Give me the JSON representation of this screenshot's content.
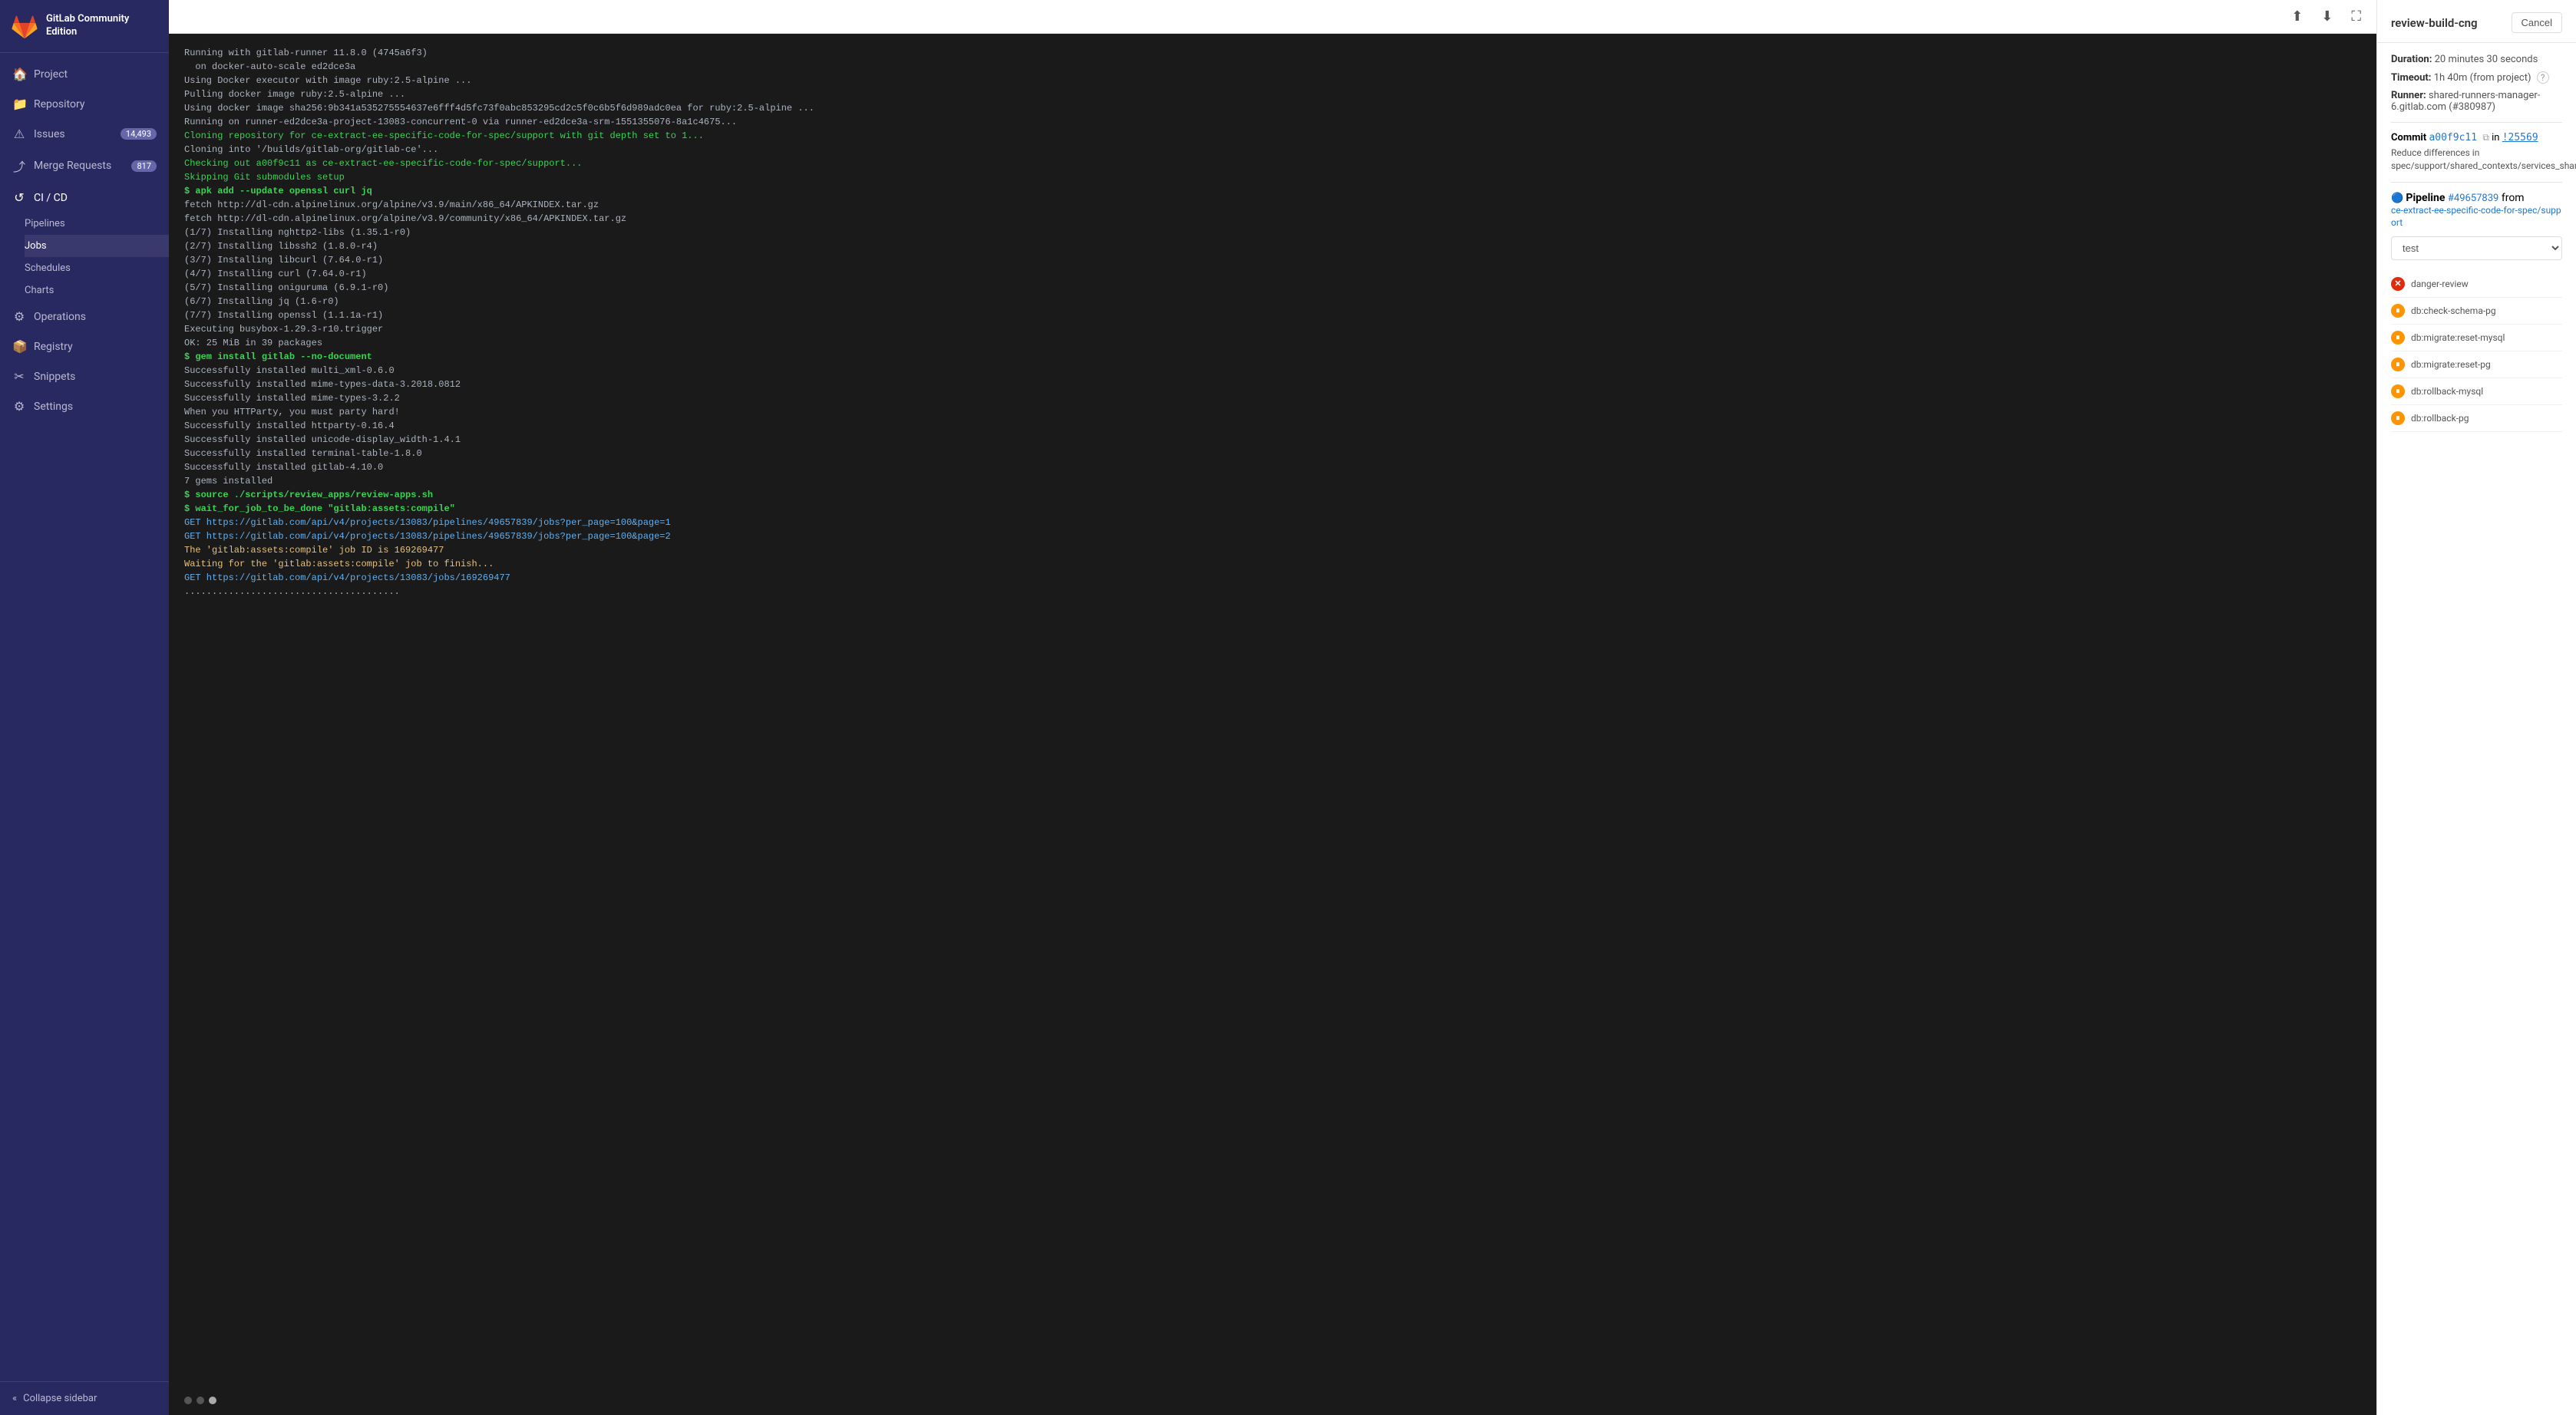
{
  "sidebar": {
    "app_name": "GitLab Community Edition",
    "logo_color": "#e24329",
    "nav_items": [
      {
        "id": "project",
        "label": "Project",
        "icon": "🏠",
        "badge": null
      },
      {
        "id": "repository",
        "label": "Repository",
        "icon": "📁",
        "badge": null
      },
      {
        "id": "issues",
        "label": "Issues",
        "icon": "⚠️",
        "badge": "14,493"
      },
      {
        "id": "merge-requests",
        "label": "Merge Requests",
        "icon": "⤴",
        "badge": "817"
      },
      {
        "id": "cicd",
        "label": "CI / CD",
        "icon": "🔁",
        "badge": null,
        "expanded": true,
        "children": [
          {
            "id": "pipelines",
            "label": "Pipelines"
          },
          {
            "id": "jobs",
            "label": "Jobs",
            "active": true
          },
          {
            "id": "schedules",
            "label": "Schedules"
          },
          {
            "id": "charts",
            "label": "Charts"
          }
        ]
      },
      {
        "id": "operations",
        "label": "Operations",
        "icon": "⚙",
        "badge": null
      },
      {
        "id": "registry",
        "label": "Registry",
        "icon": "📦",
        "badge": null
      },
      {
        "id": "snippets",
        "label": "Snippets",
        "icon": "✂",
        "badge": null
      },
      {
        "id": "settings",
        "label": "Settings",
        "icon": "⚙",
        "badge": null
      }
    ],
    "collapse_label": "Collapse sidebar"
  },
  "toolbar": {
    "scroll_to_top_icon": "⬆",
    "scroll_bottom_icon": "⬇",
    "fullscreen_icon": "⛶"
  },
  "terminal": {
    "lines": [
      {
        "text": "Running with gitlab-runner 11.8.0 (4745a6f3)",
        "style": "white"
      },
      {
        "text": "  on docker-auto-scale ed2dce3a",
        "style": "white"
      },
      {
        "text": "Using Docker executor with image ruby:2.5-alpine ...",
        "style": "white"
      },
      {
        "text": "Pulling docker image ruby:2.5-alpine ...",
        "style": "white"
      },
      {
        "text": "Using docker image sha256:9b341a535275554637e6fff4d5fc73f0abc853295cd2c5f0c6b5f6d989adc0ea for ruby:2.5-alpine ...",
        "style": "white"
      },
      {
        "text": "Running on runner-ed2dce3a-project-13083-concurrent-0 via runner-ed2dce3a-srm-1551355076-8a1c4675...",
        "style": "white"
      },
      {
        "text": "Cloning repository for ce-extract-ee-specific-code-for-spec/support with git depth set to 1...",
        "style": "green"
      },
      {
        "text": "Cloning into '/builds/gitlab-org/gitlab-ce'...",
        "style": "white"
      },
      {
        "text": "Checking out a00f9c11 as ce-extract-ee-specific-code-for-spec/support...",
        "style": "green"
      },
      {
        "text": "Skipping Git submodules setup",
        "style": "green"
      },
      {
        "text": "$ apk add --update openssl curl jq",
        "style": "cmd"
      },
      {
        "text": "fetch http://dl-cdn.alpinelinux.org/alpine/v3.9/main/x86_64/APKINDEX.tar.gz",
        "style": "white"
      },
      {
        "text": "fetch http://dl-cdn.alpinelinux.org/alpine/v3.9/community/x86_64/APKINDEX.tar.gz",
        "style": "white"
      },
      {
        "text": "(1/7) Installing nghttp2-libs (1.35.1-r0)",
        "style": "white"
      },
      {
        "text": "(2/7) Installing libssh2 (1.8.0-r4)",
        "style": "white"
      },
      {
        "text": "(3/7) Installing libcurl (7.64.0-r1)",
        "style": "white"
      },
      {
        "text": "(4/7) Installing curl (7.64.0-r1)",
        "style": "white"
      },
      {
        "text": "(5/7) Installing oniguruma (6.9.1-r0)",
        "style": "white"
      },
      {
        "text": "(6/7) Installing jq (1.6-r0)",
        "style": "white"
      },
      {
        "text": "(7/7) Installing openssl (1.1.1a-r1)",
        "style": "white"
      },
      {
        "text": "Executing busybox-1.29.3-r10.trigger",
        "style": "white"
      },
      {
        "text": "OK: 25 MiB in 39 packages",
        "style": "white"
      },
      {
        "text": "$ gem install gitlab --no-document",
        "style": "cmd"
      },
      {
        "text": "Successfully installed multi_xml-0.6.0",
        "style": "white"
      },
      {
        "text": "Successfully installed mime-types-data-3.2018.0812",
        "style": "white"
      },
      {
        "text": "Successfully installed mime-types-3.2.2",
        "style": "white"
      },
      {
        "text": "When you HTTParty, you must party hard!",
        "style": "white"
      },
      {
        "text": "Successfully installed httparty-0.16.4",
        "style": "white"
      },
      {
        "text": "Successfully installed unicode-display_width-1.4.1",
        "style": "white"
      },
      {
        "text": "Successfully installed terminal-table-1.8.0",
        "style": "white"
      },
      {
        "text": "Successfully installed gitlab-4.10.0",
        "style": "white"
      },
      {
        "text": "7 gems installed",
        "style": "white"
      },
      {
        "text": "$ source ./scripts/review_apps/review-apps.sh",
        "style": "cmd"
      },
      {
        "text": "$ wait_for_job_to_be_done \"gitlab:assets:compile\"",
        "style": "cmd"
      },
      {
        "text": "GET https://gitlab.com/api/v4/projects/13083/pipelines/49657839/jobs?per_page=100&page=1",
        "style": "url"
      },
      {
        "text": "GET https://gitlab.com/api/v4/projects/13083/pipelines/49657839/jobs?per_page=100&page=2",
        "style": "url"
      },
      {
        "text": "The 'gitlab:assets:compile' job ID is 169269477",
        "style": "yellow"
      },
      {
        "text": "Waiting for the 'gitlab:assets:compile' job to finish...",
        "style": "yellow"
      },
      {
        "text": "GET https://gitlab.com/api/v4/projects/13083/jobs/169269477",
        "style": "url"
      },
      {
        "text": ".......................................",
        "style": "white"
      }
    ],
    "dots": [
      {
        "active": false
      },
      {
        "active": false
      },
      {
        "active": true
      }
    ]
  },
  "right_panel": {
    "title": "review-build-cng",
    "cancel_label": "Cancel",
    "duration_label": "Duration:",
    "duration_value": "20 minutes 30 seconds",
    "timeout_label": "Timeout:",
    "timeout_value": "1h 40m (from project)",
    "runner_label": "Runner:",
    "runner_value": "shared-runners-manager-6.gitlab.com (#380987)",
    "commit_label": "Commit",
    "commit_hash": "a00f9c11",
    "commit_copy_icon": "⧉",
    "commit_merge_request": "!25569",
    "commit_message": "Reduce differences in spec/support/shared_contexts/services_shared_context.rb",
    "pipeline_label": "Pipeline",
    "pipeline_number": "#49657839",
    "pipeline_branch": "ce-extract-ee-specific-code-for-spec/support",
    "pipeline_from": "from",
    "stage_options": [
      "test"
    ],
    "stage_selected": "test",
    "jobs": [
      {
        "name": "danger-review",
        "status": "failed"
      },
      {
        "name": "db:check-schema-pg",
        "status": "pending"
      },
      {
        "name": "db:migrate:reset-mysql",
        "status": "pending"
      },
      {
        "name": "db:migrate:reset-pg",
        "status": "pending"
      },
      {
        "name": "db:rollback-mysql",
        "status": "pending"
      },
      {
        "name": "db:rollback-pg",
        "status": "pending"
      }
    ]
  }
}
